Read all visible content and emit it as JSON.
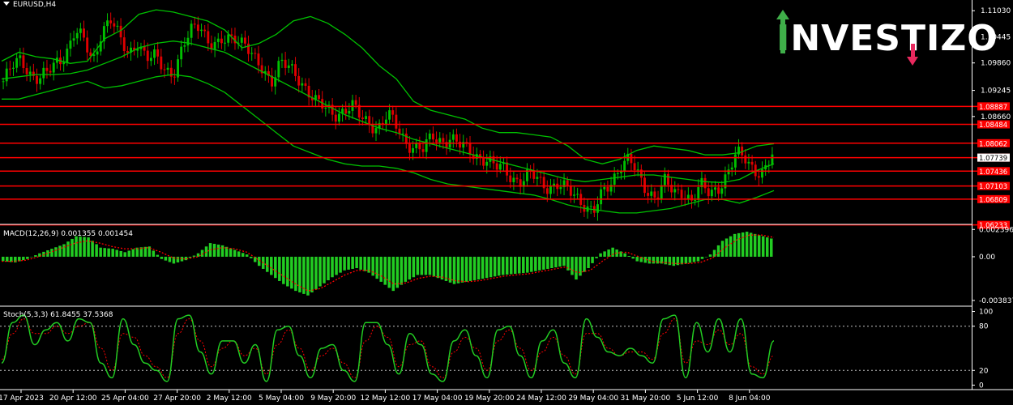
{
  "chart_data": [
    {
      "type": "candlestick",
      "title": "EURUSD,H4",
      "ylim": [
        1.0628,
        1.1127
      ],
      "y_ticks": [
        1.1103,
        1.10445,
        1.0986,
        1.09245,
        1.0866,
        1.08062,
        1.07739,
        1.07436,
        1.07103,
        1.06809,
        1.06233
      ],
      "y_tick_labels": [
        "1.11030",
        "1.10445",
        "1.09860",
        "1.09245",
        "1.08660"
      ],
      "x_tick_labels": [
        "17 Apr 2023",
        "20 Apr 12:00",
        "25 Apr 04:00",
        "27 Apr 20:00",
        "2 May 12:00",
        "5 May 04:00",
        "9 May 20:00",
        "12 May 12:00",
        "17 May 04:00",
        "19 May 20:00",
        "24 May 12:00",
        "29 May 04:00",
        "31 May 20:00",
        "5 Jun 12:00",
        "8 Jun 04:00"
      ],
      "price_path": [
        1.0945,
        1.0975,
        1.0995,
        1.0965,
        1.0948,
        1.0962,
        1.099,
        1.101,
        1.1055,
        1.1035,
        1.099,
        1.106,
        1.108,
        1.104,
        1.101,
        1.1035,
        1.099,
        1.1,
        1.098,
        1.096,
        1.101,
        1.106,
        1.108,
        1.103,
        1.102,
        1.104,
        1.105,
        1.103,
        1.099,
        1.097,
        1.095,
        1.099,
        1.097,
        1.095,
        1.093,
        1.09,
        1.088,
        1.087,
        1.0882,
        1.089,
        1.086,
        1.085,
        1.0845,
        1.087,
        1.084,
        1.081,
        1.08,
        1.079,
        1.082,
        1.0812,
        1.082,
        1.08,
        1.079,
        1.078,
        1.077,
        1.075,
        1.075,
        1.073,
        1.072,
        1.0735,
        1.0722,
        1.071,
        1.0712,
        1.07,
        1.069,
        1.0672,
        1.065,
        1.069,
        1.072,
        1.076,
        1.077,
        1.073,
        1.07,
        1.069,
        1.072,
        1.069,
        1.07,
        1.068,
        1.071,
        1.069,
        1.071,
        1.074,
        1.078,
        1.077,
        1.075,
        1.074,
        1.0775
      ],
      "bollinger": {
        "upper": [
          1.099,
          1.101,
          1.1,
          1.0995,
          1.0985,
          1.099,
          1.104,
          1.106,
          1.1095,
          1.1105,
          1.11,
          1.109,
          1.108,
          1.106,
          1.102,
          1.103,
          1.105,
          1.108,
          1.109,
          1.1075,
          1.105,
          1.102,
          1.098,
          1.095,
          1.09,
          1.088,
          1.087,
          1.086,
          1.084,
          1.083,
          1.083,
          1.0825,
          1.082,
          1.08,
          1.077,
          1.076,
          1.077,
          1.079,
          1.08,
          1.0795,
          1.079,
          1.078,
          1.078,
          1.0785,
          1.08,
          1.0805
        ],
        "middle": [
          1.095,
          1.0955,
          1.096,
          1.096,
          1.0962,
          1.097,
          1.0985,
          1.1,
          1.102,
          1.103,
          1.1035,
          1.103,
          1.102,
          1.101,
          1.099,
          1.097,
          1.095,
          1.093,
          1.091,
          1.089,
          1.087,
          1.0855,
          1.084,
          1.083,
          1.0815,
          1.0805,
          1.0795,
          1.0785,
          1.0775,
          1.0765,
          1.0755,
          1.0745,
          1.0735,
          1.0725,
          1.072,
          1.0725,
          1.073,
          1.0735,
          1.0735,
          1.073,
          1.0725,
          1.072,
          1.0718,
          1.0725,
          1.0745,
          1.076
        ],
        "lower": [
          1.0905,
          1.0905,
          1.0915,
          1.0925,
          1.0935,
          1.0945,
          1.093,
          1.0935,
          1.0945,
          1.0955,
          1.096,
          1.0955,
          1.094,
          1.092,
          1.089,
          1.086,
          1.083,
          1.08,
          1.0785,
          1.077,
          1.076,
          1.0755,
          1.0755,
          1.075,
          1.074,
          1.0725,
          1.0715,
          1.071,
          1.0705,
          1.07,
          1.0695,
          1.069,
          1.068,
          1.0668,
          1.066,
          1.0655,
          1.065,
          1.065,
          1.0655,
          1.066,
          1.067,
          1.068,
          1.068,
          1.0672,
          1.0685,
          1.07
        ]
      },
      "horizontal_levels": [
        {
          "value": 1.08887,
          "label": "1.08887"
        },
        {
          "value": 1.08484,
          "label": "1.08484"
        },
        {
          "value": 1.08062,
          "label": "1.08062"
        },
        {
          "value": 1.07739,
          "label": "1.07739"
        },
        {
          "value": 1.07436,
          "label": "1.07436"
        },
        {
          "value": 1.07103,
          "label": "1.07103"
        },
        {
          "value": 1.06809,
          "label": "1.06809"
        },
        {
          "value": 1.06233,
          "label": "1.06233"
        }
      ],
      "colors": {
        "bull": "#00c000",
        "bear": "#e00000",
        "bands": "#00c000",
        "levels": "#ff0000"
      }
    },
    {
      "type": "bar",
      "title": "MACD(12,26,9) 0.001355 0.001454",
      "ylim": [
        -0.0042,
        0.0027
      ],
      "y_tick_labels": [
        "0.002396",
        "0.00",
        "-0.003837"
      ],
      "y_ticks": [
        0.002396,
        0,
        -0.003837
      ],
      "values": [
        -0.0004,
        -0.0005,
        -0.0002,
        0.0003,
        0.0007,
        0.0011,
        0.0018,
        0.0017,
        0.0008,
        0.0007,
        0.0004,
        0.0008,
        0.0009,
        -0.0002,
        -0.0006,
        -0.0003,
        0.0003,
        0.0012,
        0.001,
        0.0006,
        0.0002,
        -0.0008,
        -0.0016,
        -0.0024,
        -0.003,
        -0.0034,
        -0.0026,
        -0.0018,
        -0.0012,
        -0.001,
        -0.0014,
        -0.0022,
        -0.003,
        -0.0022,
        -0.0016,
        -0.0016,
        -0.002,
        -0.0024,
        -0.0022,
        -0.002,
        -0.0018,
        -0.0016,
        -0.0015,
        -0.0014,
        -0.0012,
        -0.001,
        -0.0008,
        -0.002,
        -0.001,
        0.0003,
        0.0008,
        0.0003,
        -0.0004,
        -0.0006,
        -0.0006,
        -0.0008,
        -0.0006,
        -0.0004,
        0.0002,
        0.0014,
        0.002,
        0.0022,
        0.0019,
        0.0016
      ],
      "signal": [
        -0.0004,
        -0.0004,
        -0.0003,
        0.0,
        0.0004,
        0.0008,
        0.0012,
        0.0014,
        0.0012,
        0.0009,
        0.0007,
        0.0007,
        0.0008,
        0.0004,
        -0.0001,
        -0.0002,
        0.0,
        0.0006,
        0.0008,
        0.0007,
        0.0004,
        -0.0003,
        -0.001,
        -0.0017,
        -0.0024,
        -0.003,
        -0.0028,
        -0.0022,
        -0.0016,
        -0.0012,
        -0.0012,
        -0.0017,
        -0.0024,
        -0.0023,
        -0.0019,
        -0.0017,
        -0.0018,
        -0.0021,
        -0.0022,
        -0.0021,
        -0.0019,
        -0.0017,
        -0.0016,
        -0.0015,
        -0.0013,
        -0.0011,
        -0.0009,
        -0.0014,
        -0.0012,
        -0.0004,
        0.0003,
        0.0004,
        0.0,
        -0.0004,
        -0.0005,
        -0.0006,
        -0.0006,
        -0.0005,
        -0.0001,
        0.0008,
        0.0015,
        0.0019,
        0.0019,
        0.0017
      ],
      "colors": {
        "bars": "#22cc22",
        "signal": "#ff0000"
      }
    },
    {
      "type": "line",
      "title": "Stoch(5,3,3) 61.8455 37.5368",
      "ylim": [
        -5,
        105
      ],
      "y_tick_labels": [
        "100",
        "80",
        "20",
        "0"
      ],
      "y_ticks": [
        100,
        80,
        20,
        0
      ],
      "values": [
        30,
        85,
        95,
        55,
        75,
        85,
        60,
        90,
        85,
        30,
        10,
        90,
        55,
        30,
        20,
        5,
        90,
        95,
        45,
        15,
        60,
        60,
        30,
        55,
        5,
        75,
        80,
        40,
        10,
        50,
        55,
        20,
        5,
        85,
        85,
        55,
        15,
        70,
        55,
        15,
        5,
        60,
        75,
        40,
        10,
        75,
        80,
        40,
        10,
        60,
        75,
        30,
        10,
        90,
        65,
        45,
        40,
        50,
        40,
        30,
        90,
        95,
        10,
        85,
        45,
        90,
        45,
        90,
        15,
        10,
        60
      ],
      "signal": [
        35,
        70,
        90,
        70,
        70,
        80,
        70,
        80,
        85,
        50,
        20,
        70,
        65,
        40,
        25,
        10,
        70,
        90,
        60,
        25,
        50,
        60,
        40,
        50,
        15,
        55,
        75,
        50,
        20,
        40,
        50,
        30,
        10,
        60,
        80,
        65,
        25,
        55,
        60,
        25,
        10,
        45,
        65,
        50,
        20,
        60,
        75,
        50,
        20,
        45,
        65,
        40,
        15,
        70,
        70,
        50,
        40,
        45,
        45,
        35,
        70,
        90,
        30,
        60,
        55,
        75,
        55,
        70,
        25,
        15,
        40
      ],
      "colors": {
        "main": "#22cc22",
        "signal": "#ff0000"
      }
    }
  ],
  "logo": {
    "letters_left": "I",
    "letters_mid": "NVEST",
    "letters_i": "I",
    "letters_right": "ZO"
  },
  "symbol_label": "EURUSD,H4"
}
